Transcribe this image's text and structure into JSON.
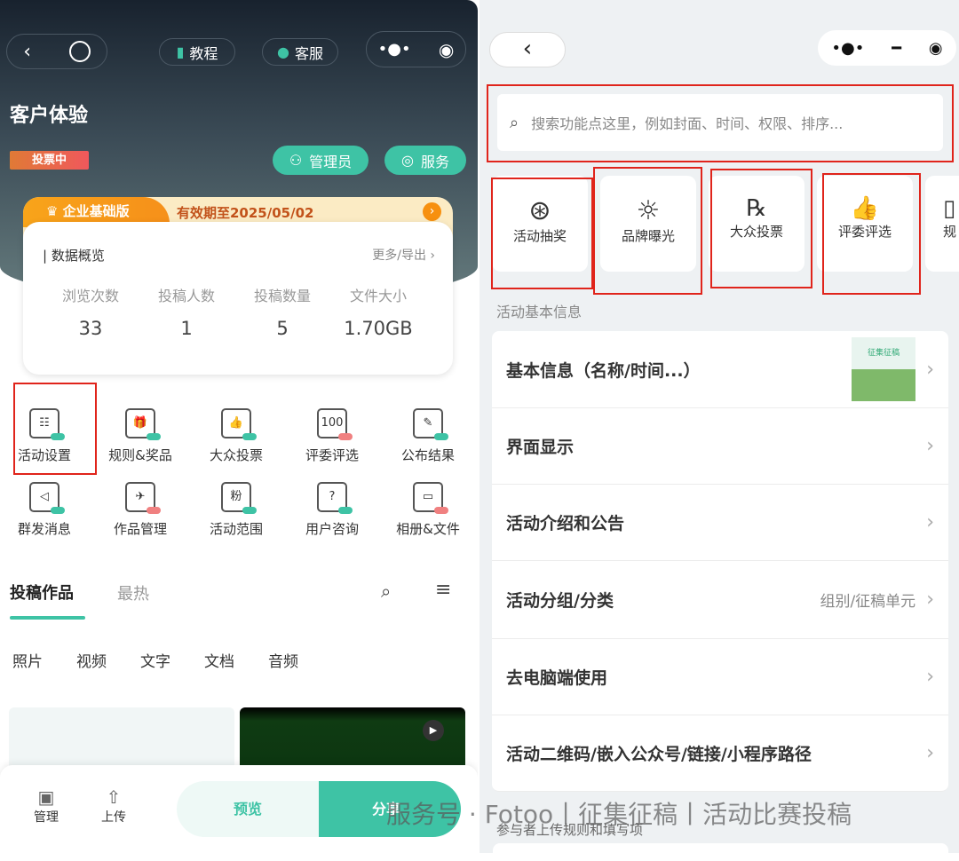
{
  "left": {
    "nav": {
      "tutorial": "教程",
      "service": "客服"
    },
    "title": "客户体验",
    "status_badge": "投票中",
    "admin_btn": "管理员",
    "service_btn": "服务",
    "plan": {
      "name": "企业基础版",
      "expiry": "有效期至2025/05/02"
    },
    "overview": {
      "title": "| 数据概览",
      "more": "更多/导出 ›",
      "stats": [
        {
          "label": "浏览次数",
          "value": "33"
        },
        {
          "label": "投稿人数",
          "value": "1"
        },
        {
          "label": "投稿数量",
          "value": "5"
        },
        {
          "label": "文件大小",
          "value": "1.70GB"
        }
      ]
    },
    "grid": [
      {
        "label": "活动设置",
        "glyph": "☷",
        "dot": "#3ec3a5"
      },
      {
        "label": "规则&奖品",
        "glyph": "🎁",
        "dot": "#3ec3a5"
      },
      {
        "label": "大众投票",
        "glyph": "👍",
        "dot": "#3ec3a5"
      },
      {
        "label": "评委评选",
        "glyph": "100",
        "dot": "#f08080"
      },
      {
        "label": "公布结果",
        "glyph": "✎",
        "dot": "#3ec3a5"
      },
      {
        "label": "群发消息",
        "glyph": "◁",
        "dot": "#3ec3a5"
      },
      {
        "label": "作品管理",
        "glyph": "✈",
        "dot": "#f08080"
      },
      {
        "label": "活动范围",
        "glyph": "粉",
        "dot": "#3ec3a5"
      },
      {
        "label": "用户咨询",
        "glyph": "?",
        "dot": "#3ec3a5"
      },
      {
        "label": "相册&文件",
        "glyph": "▭",
        "dot": "#f08080"
      }
    ],
    "tabs": [
      "投稿作品",
      "最热"
    ],
    "filters": [
      "照片",
      "视频",
      "文字",
      "文档",
      "音频"
    ],
    "bottom": {
      "manage": "管理",
      "upload": "上传",
      "preview": "预览",
      "share": "分享"
    }
  },
  "right": {
    "search_placeholder": "搜索功能点这里，例如封面、时间、权限、排序...",
    "functions": [
      {
        "label": "活动抽奖",
        "icon": "wheel-icon"
      },
      {
        "label": "品牌曝光",
        "icon": "sun-icon"
      },
      {
        "label": "大众投票",
        "icon": "rank-icon"
      },
      {
        "label": "评委评选",
        "icon": "thumb-icon"
      },
      {
        "label": "规",
        "icon": "rule-icon"
      }
    ],
    "section_label": "活动基本信息",
    "rows": [
      {
        "label": "基本信息（名称/时间...）",
        "sub": ""
      },
      {
        "label": "界面显示",
        "sub": ""
      },
      {
        "label": "活动介绍和公告",
        "sub": ""
      },
      {
        "label": "活动分组/分类",
        "sub": "组别/征稿单元"
      },
      {
        "label": "去电脑端使用",
        "sub": ""
      },
      {
        "label": "活动二维码/嵌入公众号/链接/小程序路径",
        "sub": ""
      }
    ],
    "footer_label": "参与者上传规则和填写项",
    "thumb_text": "征集征稿"
  },
  "watermark": "服务号 · Fotoo丨征集征稿丨活动比赛投稿",
  "colors": {
    "accent": "#3ec3a5",
    "highlight": "#e0241b",
    "badge": "#f0585c",
    "plan": "#f7a21b"
  }
}
